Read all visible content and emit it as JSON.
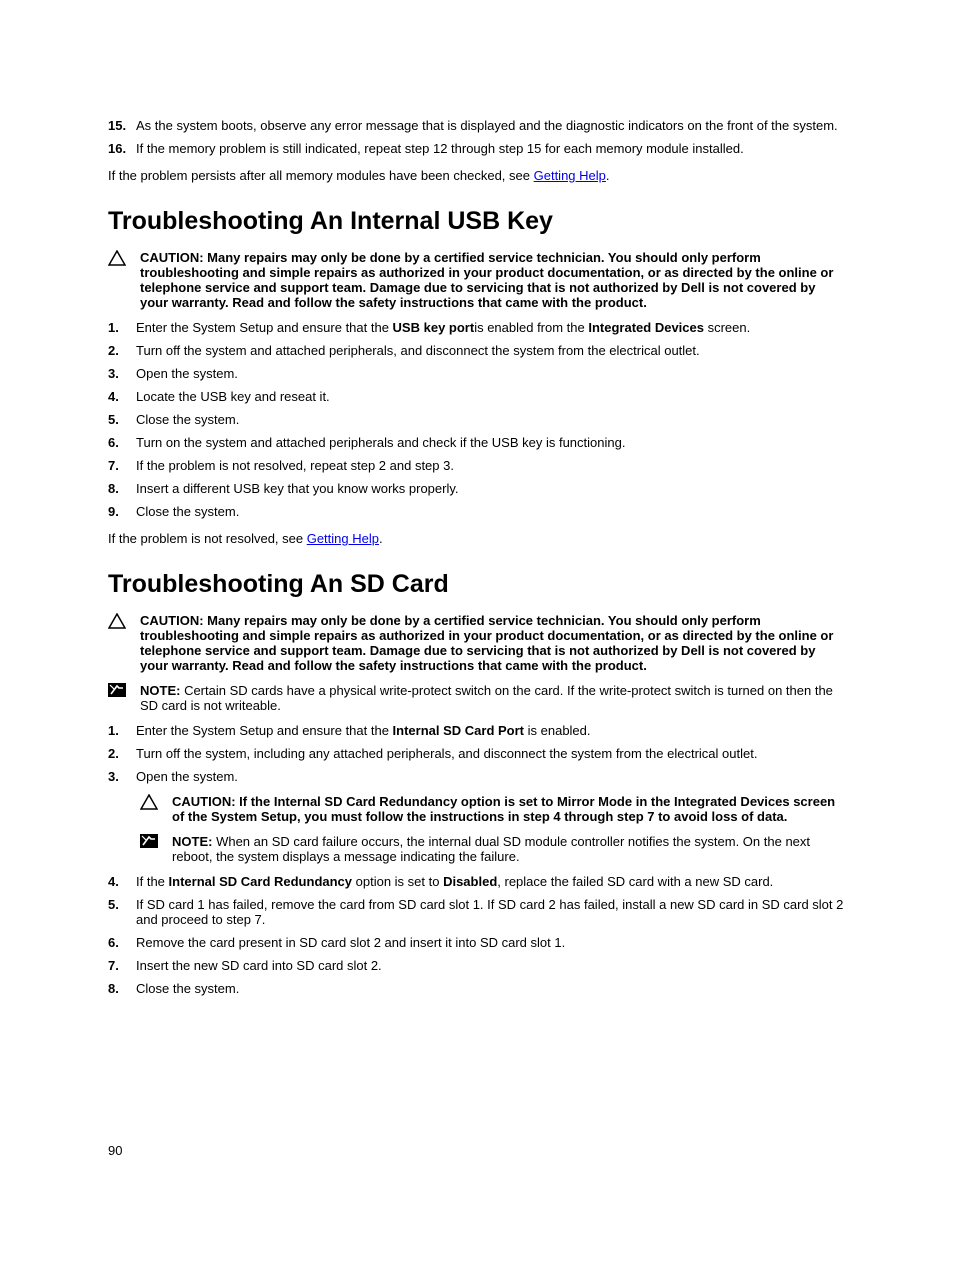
{
  "top_steps": [
    {
      "num": "15.",
      "text": "As the system boots, observe any error message that is displayed and the diagnostic indicators on the front of the system."
    },
    {
      "num": "16.",
      "text": "If the memory problem is still indicated, repeat step 12 through step 15 for each memory module installed."
    }
  ],
  "top_para_pre": "If the problem persists after all memory modules have been checked, see ",
  "getting_help": "Getting Help",
  "period": ".",
  "heading_usb": "Troubleshooting An Internal USB Key",
  "caution_label": "CAUTION: ",
  "caution_text": "Many repairs may only be done by a certified service technician. You should only perform troubleshooting and simple repairs as authorized in your product documentation, or as directed by the online or telephone service and support team. Damage due to servicing that is not authorized by Dell is not covered by your warranty. Read and follow the safety instructions that came with the product.",
  "usb_steps": [
    {
      "num": "1.",
      "parts": [
        {
          "t": "Enter the System Setup and ensure that the "
        },
        {
          "t": "USB key port",
          "b": true
        },
        {
          "t": "is enabled from the "
        },
        {
          "t": "Integrated Devices",
          "b": true
        },
        {
          "t": " screen."
        }
      ]
    },
    {
      "num": "2.",
      "parts": [
        {
          "t": "Turn off the system and attached peripherals, and disconnect the system from the electrical outlet."
        }
      ]
    },
    {
      "num": "3.",
      "parts": [
        {
          "t": "Open the system."
        }
      ]
    },
    {
      "num": "4.",
      "parts": [
        {
          "t": "Locate the USB key and reseat it."
        }
      ]
    },
    {
      "num": "5.",
      "parts": [
        {
          "t": "Close the system."
        }
      ]
    },
    {
      "num": "6.",
      "parts": [
        {
          "t": "Turn on the system and attached peripherals and check if the USB key is functioning."
        }
      ]
    },
    {
      "num": "7.",
      "parts": [
        {
          "t": "If the problem is not resolved, repeat step 2 and step 3."
        }
      ]
    },
    {
      "num": "8.",
      "parts": [
        {
          "t": "Insert a different USB key that you know works properly."
        }
      ]
    },
    {
      "num": "9.",
      "parts": [
        {
          "t": "Close the system."
        }
      ]
    }
  ],
  "usb_para_pre": "If the problem is not resolved, see ",
  "heading_sd": "Troubleshooting An SD Card",
  "note_label": "NOTE: ",
  "note_sd_writeprotect": "Certain SD cards have a physical write-protect switch on the card. If the write-protect switch is turned on then the SD card is not writeable.",
  "sd_steps_first": [
    {
      "num": "1.",
      "parts": [
        {
          "t": "Enter the System Setup and ensure that the "
        },
        {
          "t": "Internal SD Card Port",
          "b": true
        },
        {
          "t": " is enabled."
        }
      ]
    },
    {
      "num": "2.",
      "parts": [
        {
          "t": "Turn off the system, including any attached peripherals, and disconnect the system from the electrical outlet."
        }
      ]
    },
    {
      "num": "3.",
      "parts": [
        {
          "t": "Open the system."
        }
      ]
    }
  ],
  "sd_caution_inner": "If the Internal SD Card Redundancy option is set to Mirror Mode in the Integrated Devices screen of the System Setup, you must follow the instructions in step 4 through step 7 to avoid loss of data.",
  "sd_note_inner": "When an SD card failure occurs, the internal dual SD module controller notifies the system. On the next reboot, the system displays a message indicating the failure.",
  "sd_steps_rest": [
    {
      "num": "4.",
      "parts": [
        {
          "t": "If the "
        },
        {
          "t": "Internal SD Card Redundancy",
          "b": true
        },
        {
          "t": " option is set to "
        },
        {
          "t": "Disabled",
          "b": true
        },
        {
          "t": ", replace the failed SD card with a new SD card."
        }
      ]
    },
    {
      "num": "5.",
      "parts": [
        {
          "t": "If SD card 1 has failed, remove the card from SD card slot 1. If SD card 2 has failed, install a new SD card in SD card slot 2 and proceed to step 7."
        }
      ]
    },
    {
      "num": "6.",
      "parts": [
        {
          "t": "Remove the card present in SD card slot 2 and insert it into SD card slot 1."
        }
      ]
    },
    {
      "num": "7.",
      "parts": [
        {
          "t": "Insert the new SD card into SD card slot 2."
        }
      ]
    },
    {
      "num": "8.",
      "parts": [
        {
          "t": "Close the system."
        }
      ]
    }
  ],
  "page_number": "90"
}
